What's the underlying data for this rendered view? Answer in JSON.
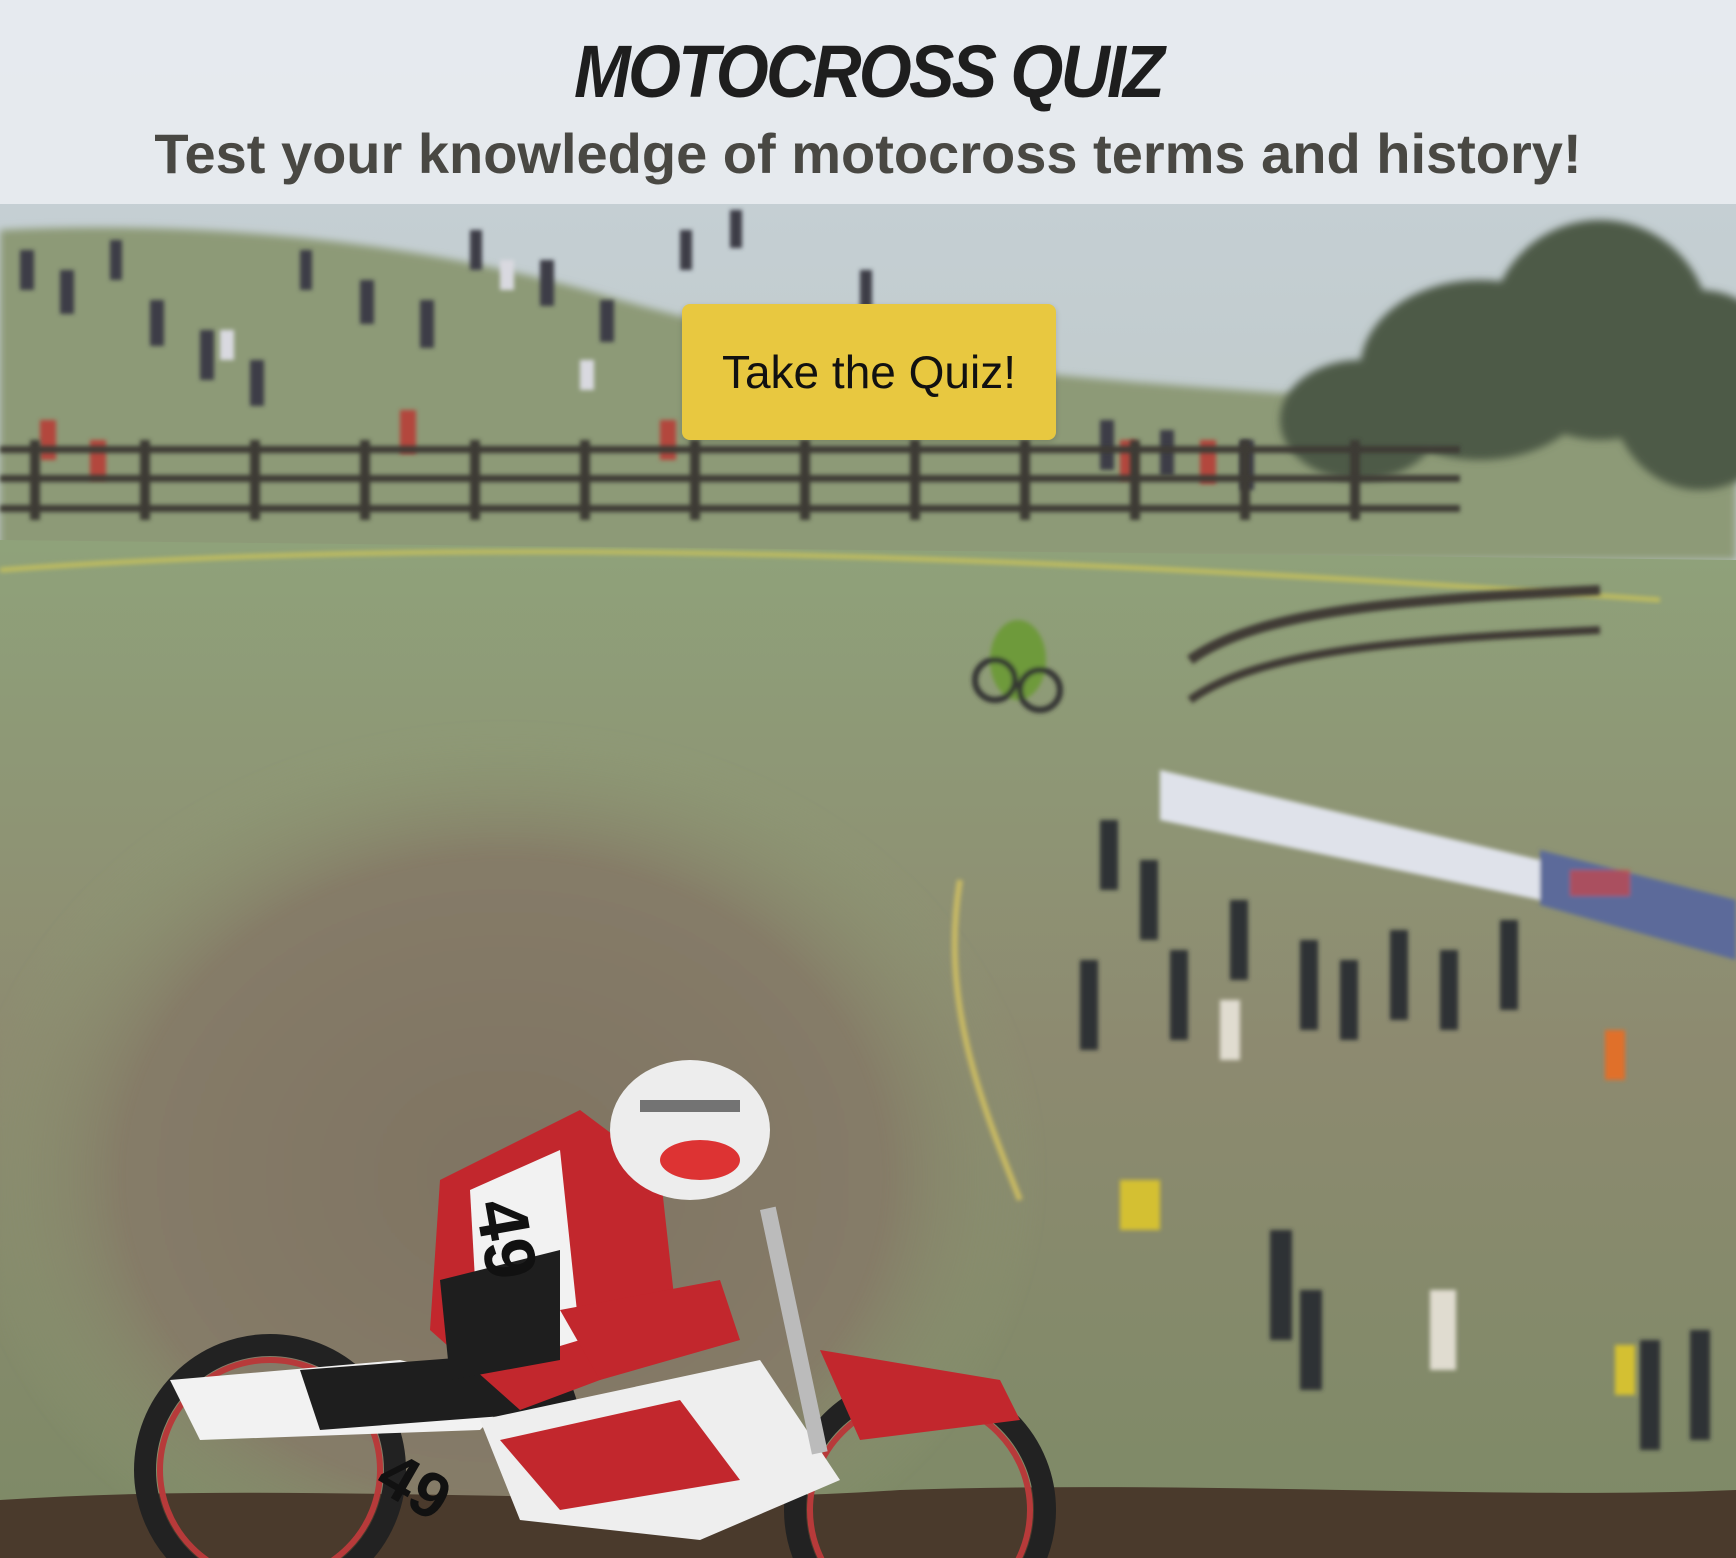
{
  "header": {
    "title": "MOTOCROSS QUIZ",
    "subtitle": "Test your knowledge of motocross terms and history!"
  },
  "cta": {
    "label": "Take the Quiz!"
  },
  "rider_number": "49",
  "colors": {
    "header_bg": "#e8ecf0",
    "title": "#1e1e1e",
    "subtitle": "#494843",
    "button_bg": "#e8c840",
    "button_text": "#111111"
  },
  "icons": {
    "background": "motocross-race-photo"
  }
}
